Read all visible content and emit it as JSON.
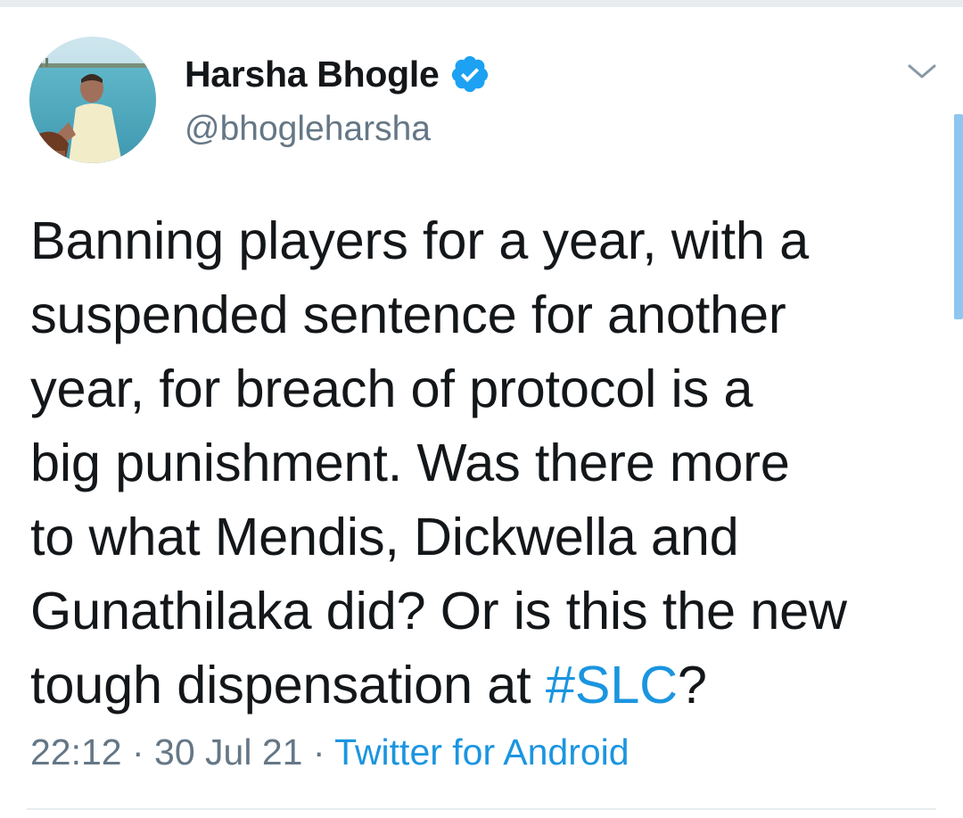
{
  "author": {
    "display_name": "Harsha Bhogle",
    "handle": "@bhogleharsha",
    "verified": true,
    "verified_color": "#1da1f2"
  },
  "tweet": {
    "lines": [
      "Banning players for a year, with a",
      "suspended sentence for another",
      "year, for breach of protocol is a",
      "big punishment. Was there more",
      "to what Mendis, Dickwella and",
      "Gunathilaka did? Or is this the new"
    ],
    "last_line_prefix": "tough dispensation at ",
    "hashtag": "#SLC",
    "last_line_suffix": "?"
  },
  "meta": {
    "time": "22:12",
    "separator": " · ",
    "date": "30 Jul 21",
    "source": "Twitter for Android"
  },
  "icons": {
    "caret": "chevron-down-icon",
    "verified": "verified-badge-icon"
  },
  "colors": {
    "link": "#1b95e0",
    "secondary_text": "#657786",
    "primary_text": "#14171a"
  }
}
